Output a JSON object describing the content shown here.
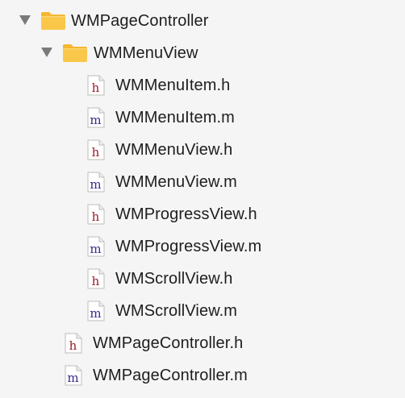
{
  "tree": {
    "root": {
      "label": "WMPageController",
      "icon": "folder-icon",
      "expanded": true
    },
    "group": {
      "label": "WMMenuView",
      "icon": "folder-icon",
      "expanded": true
    },
    "group_files": [
      {
        "label": "WMMenuItem.h",
        "type": "h"
      },
      {
        "label": "WMMenuItem.m",
        "type": "m"
      },
      {
        "label": "WMMenuView.h",
        "type": "h"
      },
      {
        "label": "WMMenuView.m",
        "type": "m"
      },
      {
        "label": "WMProgressView.h",
        "type": "h"
      },
      {
        "label": "WMProgressView.m",
        "type": "m"
      },
      {
        "label": "WMScrollView.h",
        "type": "h"
      },
      {
        "label": "WMScrollView.m",
        "type": "m"
      }
    ],
    "root_files": [
      {
        "label": "WMPageController.h",
        "type": "h"
      },
      {
        "label": "WMPageController.m",
        "type": "m"
      }
    ]
  },
  "colors": {
    "background": "#f5f5f5",
    "folder_body": "#f9c74a",
    "folder_tab": "#f4b730",
    "disclosure": "#7a7a7a",
    "header_letter": "#9b1b2a",
    "impl_letter": "#3d2a8a"
  }
}
